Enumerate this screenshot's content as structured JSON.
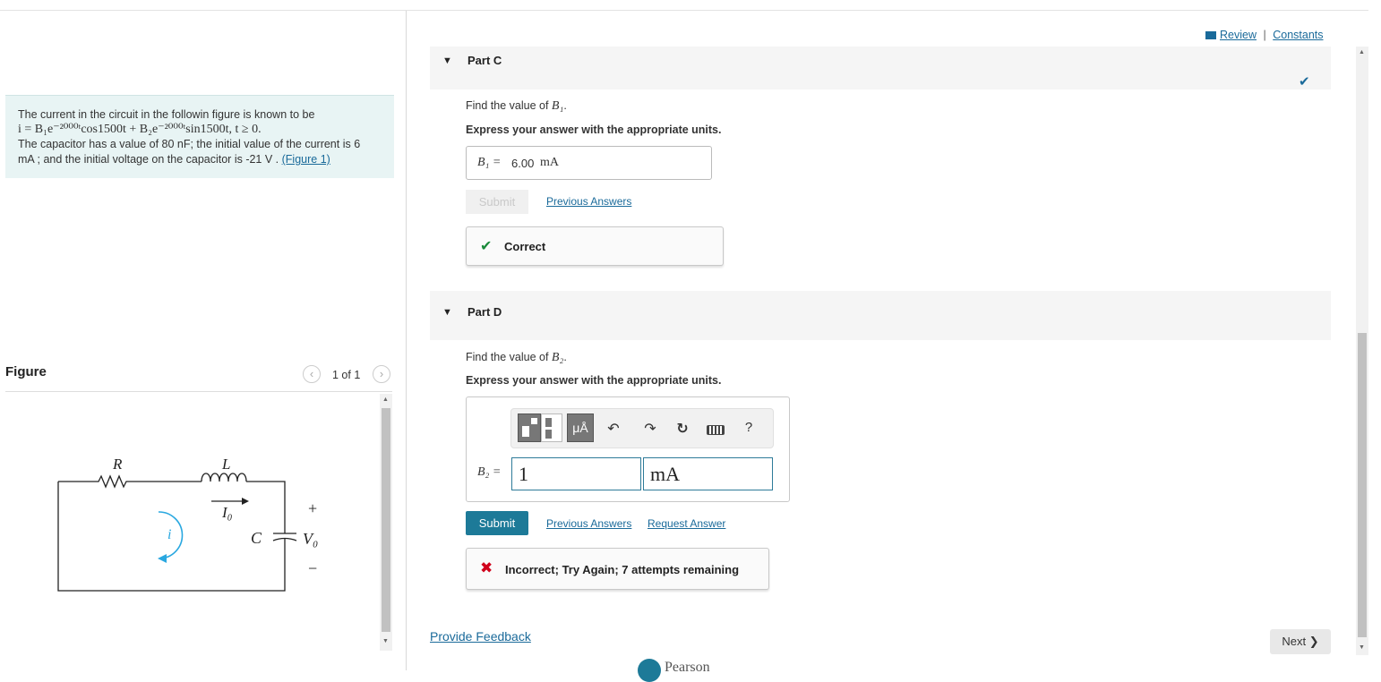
{
  "header": {
    "review_label": "Review",
    "separator": "|",
    "constants_label": "Constants"
  },
  "problem": {
    "line1": "The current in the circuit in the followin figure is known to be",
    "equation": "i = B₁e⁻²⁰⁰⁰ᵗcos1500t + B₂e⁻²⁰⁰⁰ᵗsin1500t, t ≥ 0.",
    "line3": "The capacitor has a value of 80 nF; the initial value of the current is 6",
    "line4": "mA ; and the initial voltage on the capacitor is -21 V .",
    "figure_link": "(Figure 1)"
  },
  "figure": {
    "title": "Figure",
    "counter": "1 of 1",
    "prev_icon": "‹",
    "next_icon": "›",
    "labels": {
      "R": "R",
      "L": "L",
      "I0": "I₀",
      "C": "C",
      "V0": "V₀",
      "plus": "+",
      "minus": "−",
      "i": "i"
    }
  },
  "partC": {
    "title": "Part C",
    "prompt_prefix": "Find the value of ",
    "variable": "B₁",
    "prompt_suffix": ".",
    "instruction": "Express your answer with the appropriate units.",
    "answer_label": "B₁ =",
    "answer_value": "6.00",
    "answer_unit": "mA",
    "submit_label": "Submit",
    "previous_answers": "Previous Answers",
    "feedback": "Correct",
    "status_color": "#1a8a3a"
  },
  "partD": {
    "title": "Part D",
    "prompt_prefix": "Find the value of ",
    "variable": "B₂",
    "prompt_suffix": ".",
    "instruction": "Express your answer with the appropriate units.",
    "answer_label": "B₂ =",
    "value_input": "1",
    "unit_input": "mA",
    "toolbar": {
      "templates_icon": "templates-icon",
      "units_label": "μÅ",
      "help_label": "?"
    },
    "submit_label": "Submit",
    "previous_answers": "Previous Answers",
    "request_answer": "Request Answer",
    "feedback": "Incorrect; Try Again; 7 attempts remaining",
    "error_color": "#d0021b"
  },
  "footer": {
    "provide_feedback": "Provide Feedback",
    "next_label": "Next",
    "pearson": "Pearson"
  },
  "colors": {
    "accent": "#1d7a98",
    "link": "#1a6a9a",
    "figure_arrow": "#2aa8e0"
  }
}
